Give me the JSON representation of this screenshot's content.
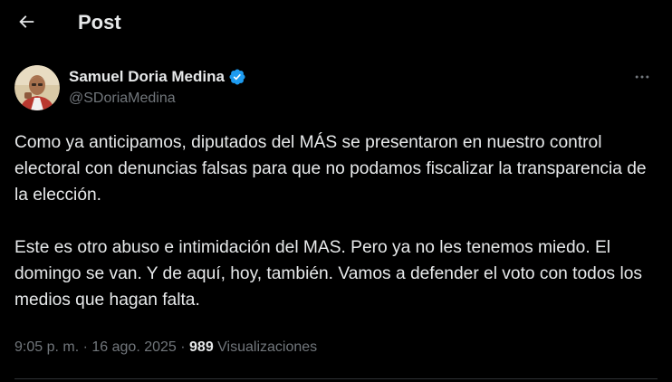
{
  "header": {
    "title": "Post",
    "back_icon": "arrow-left-icon"
  },
  "author": {
    "display_name": "Samuel Doria Medina",
    "handle": "@SDoriaMedina",
    "verified": true,
    "verified_icon": "verified-badge-icon",
    "verified_color": "#1d9bf0",
    "more_icon": "more-horizontal-icon"
  },
  "post": {
    "paragraphs": [
      "Como ya anticipamos, diputados del MÁS se presentaron en nuestro control electoral con denuncias falsas para que no podamos fiscalizar la transparencia de la elección.",
      "Este es otro abuso e intimidación del MAS. Pero ya no les tenemos miedo. El domingo se van. Y de aquí, hoy, también. Vamos a defender el voto con todos los medios que hagan falta."
    ]
  },
  "meta": {
    "time": "9:05 p. m.",
    "separator": " · ",
    "date": "16 ago. 2025",
    "views_count": "989",
    "views_label": "Visualizaciones"
  },
  "colors": {
    "background": "#000000",
    "text_primary": "#e7e9ea",
    "text_secondary": "#71767b",
    "divider": "#2f3336"
  }
}
